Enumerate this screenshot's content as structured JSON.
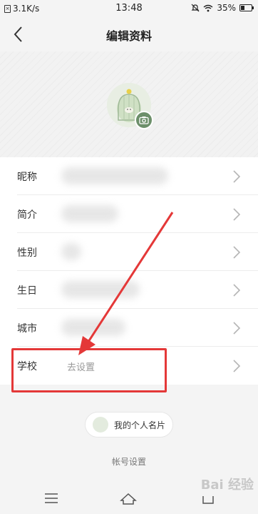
{
  "status_bar": {
    "network_speed": "3.1K/s",
    "time": "13:48",
    "battery": "35%"
  },
  "header": {
    "title": "编辑资料"
  },
  "profile_rows": [
    {
      "label": "昵称",
      "value": ""
    },
    {
      "label": "简介",
      "value": ""
    },
    {
      "label": "性别",
      "value": ""
    },
    {
      "label": "生日",
      "value": ""
    },
    {
      "label": "城市",
      "value": ""
    },
    {
      "label": "学校",
      "value": "去设置"
    }
  ],
  "card_button": {
    "label": "我的个人名片"
  },
  "account_settings": {
    "label": "帐号设置"
  },
  "watermark": {
    "text": "Bai 经验"
  },
  "colors": {
    "highlight": "#e43838",
    "camera_badge": "#6c8f6a"
  }
}
